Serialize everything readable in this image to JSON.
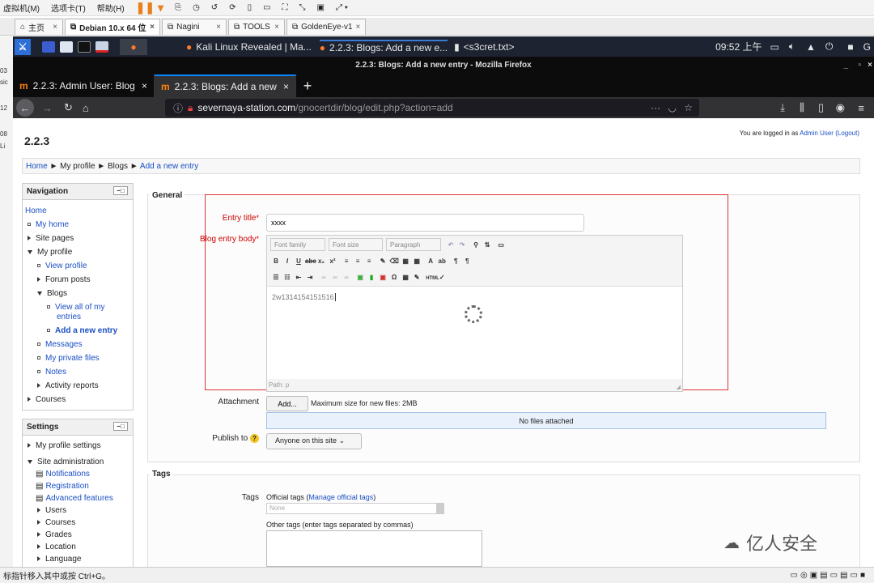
{
  "vm": {
    "menu": [
      "虚拟机(M)",
      "选项卡(T)",
      "帮助(H)"
    ],
    "tabs": [
      {
        "label": "主页",
        "icon": "home-icon"
      },
      {
        "label": "Debian 10.x 64 位",
        "icon": "vm-icon"
      },
      {
        "label": "Nagini",
        "icon": "vm-icon"
      },
      {
        "label": "TOOLS",
        "icon": "vm-icon"
      },
      {
        "label": "GoldenEye-v1",
        "icon": "vm-icon"
      }
    ],
    "status_hint": "标指针移入其中或按 Ctrl+G。",
    "left_edge": [
      "03",
      "sic",
      "12",
      "08",
      "Li"
    ]
  },
  "kali": {
    "task1": "Kali Linux Revealed | Ma...",
    "task2": "2.2.3: Blogs: Add a new e...",
    "task3": "<s3cret.txt>",
    "clock": "09:52 上午"
  },
  "firefox": {
    "window_title": "2.2.3: Blogs: Add a new entry - Mozilla Firefox",
    "tabs": [
      {
        "label": "2.2.3: Admin User: Blog",
        "active": false
      },
      {
        "label": "2.2.3: Blogs: Add a new e",
        "active": true
      }
    ],
    "url_host": "severnaya-station.com",
    "url_path": "/gnocertdir/blog/edit.php?action=add",
    "url_more": "···"
  },
  "page": {
    "site_title": "2.2.3",
    "login_prefix": "You are logged in as",
    "login_user": "Admin User",
    "logout": "(Logout)",
    "breadcrumb": [
      "Home",
      "My profile",
      "Blogs",
      "Add a new entry"
    ],
    "sep": "►",
    "navigation": {
      "title": "Navigation",
      "control": "−□",
      "home": "Home",
      "my_home": "My home",
      "site_pages": "Site pages",
      "my_profile": "My profile",
      "view_profile": "View profile",
      "forum_posts": "Forum posts",
      "blogs": "Blogs",
      "view_all_1": "View all of my",
      "view_all_2": "entries",
      "add_entry": "Add a new entry",
      "messages": "Messages",
      "private_files": "My private files",
      "notes": "Notes",
      "activity": "Activity reports",
      "courses": "Courses"
    },
    "settings": {
      "title": "Settings",
      "control": "−□",
      "profile_settings": "My profile settings",
      "site_admin": "Site administration",
      "notifications": "Notifications",
      "registration": "Registration",
      "advanced": "Advanced features",
      "users": "Users",
      "courses": "Courses",
      "grades": "Grades",
      "location": "Location",
      "language": "Language"
    },
    "form": {
      "general": "General",
      "entry_title_label": "Entry title",
      "entry_title_value": "xxxx",
      "body_label": "Blog entry body",
      "required": "*",
      "font_family": "Font family",
      "font_size": "Font size",
      "paragraph": "Paragraph",
      "body_text": "2w1314154151516",
      "path": "Path: p",
      "attachment_label": "Attachment",
      "add_button": "Add...",
      "max_size": "Maximum size for new files: 2MB",
      "no_files": "No files attached",
      "publish_label": "Publish to",
      "help": "?",
      "publish_value": "Anyone on this site",
      "tags_legend": "Tags",
      "tags_label": "Tags",
      "official_tags": "Official tags (",
      "manage_tags": "Manage official tags",
      "official_tags_close": ")",
      "none": "None",
      "other_tags": "Other tags (enter tags separated by commas)"
    },
    "watermark": "亿人安全"
  }
}
